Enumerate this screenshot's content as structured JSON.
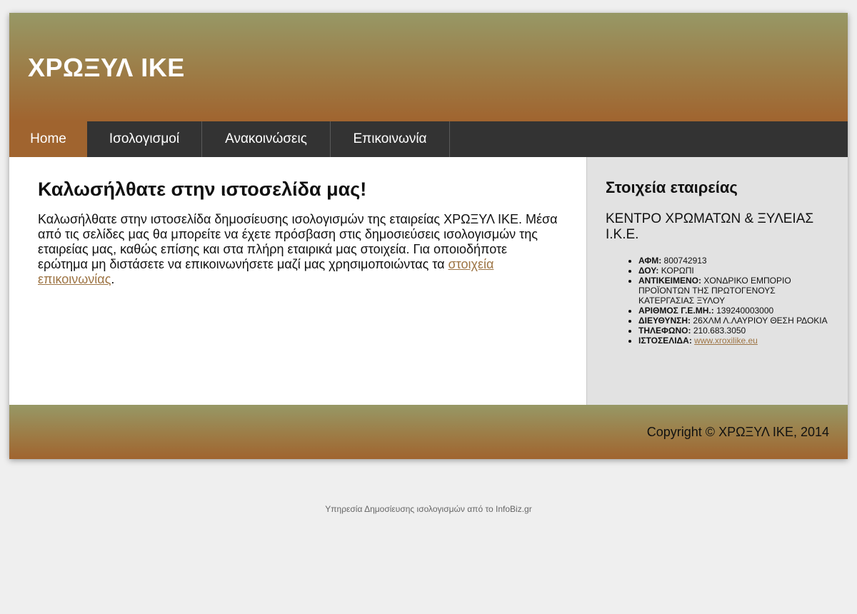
{
  "header": {
    "logo": "ΧΡΩΞΥΛ ΙΚΕ"
  },
  "nav": {
    "items": [
      {
        "label": "Home"
      },
      {
        "label": "Ισολογισμοί"
      },
      {
        "label": "Ανακοινώσεις"
      },
      {
        "label": "Επικοινωνία"
      }
    ]
  },
  "main": {
    "title": "Καλωσήλθατε στην ιστοσελίδα μας!",
    "text": "Καλωσήλθατε στην ιστοσελίδα δημοσίευσης ισολογισμών της εταιρείας ΧΡΩΞΥΛ ΙΚΕ. Μέσα από τις σελίδες μας θα μπορείτε να έχετε πρόσβαση στις δημοσιεύσεις ισολογισμών της εταιρείας μας, καθώς επίσης και στα πλήρη εταιρικά μας στοιχεία. Για οποιοδήποτε ερώτημα μη διστάσετε να επικοινωνήσετε μαζί μας χρησιμοποιώντας τα ",
    "link": "στοιχεία επικοινωνίας",
    "text_end": "."
  },
  "sidebar": {
    "title": "Στοιχεία εταιρείας",
    "company": "ΚΕΝΤΡΟ ΧΡΩΜΑΤΩΝ & ΞΥΛΕΙΑΣ Ι.Κ.Ε.",
    "details": [
      {
        "label": "ΑΦΜ:",
        "value": "800742913"
      },
      {
        "label": "ΔΟΥ:",
        "value": "ΚΟΡΩΠΙ"
      },
      {
        "label": "ΑΝΤΙΚΕΙΜΕΝΟ:",
        "value": "ΧΟΝΔΡΙΚΟ ΕΜΠΟΡΙΟ ΠΡΟΪΟΝΤΩΝ ΤΗΣ ΠΡΩΤΟΓΕΝΟΥΣ ΚΑΤΕΡΓΑΣΙΑΣ ΞΥΛΟΥ"
      },
      {
        "label": "ΑΡΙΘΜΟΣ Γ.Ε.ΜΗ.:",
        "value": "139240003000"
      },
      {
        "label": "ΔΙΕΥΘΥΝΣΗ:",
        "value": "26ΧΛΜ Λ.ΛΑΥΡΙΟΥ ΘΕΣΗ ΡΔΟΚΙΑ"
      },
      {
        "label": "ΤΗΛΕΦΩΝΟ:",
        "value": "210.683.3050"
      },
      {
        "label": "ΙΣΤΟΣΕΛΙΔΑ:",
        "value": "www.xroxilike.eu"
      }
    ]
  },
  "footer": {
    "copyright": "Copyright © ΧΡΩΞΥΛ ΙΚΕ, 2014"
  },
  "credit": "Υπηρεσία Δημοσίευσης ισολογισμών από το InfoBiz.gr",
  "colors": {
    "accent": "#a0642f",
    "nav_bg": "#333333",
    "link": "#9d7444"
  }
}
